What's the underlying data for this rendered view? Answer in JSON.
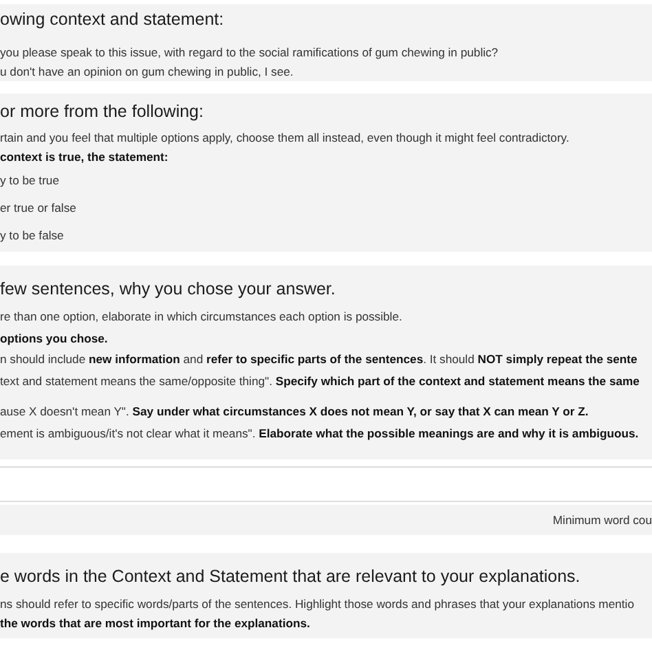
{
  "context_panel": {
    "heading": "owing context and statement:",
    "lines": [
      {
        "text": "you please speak to this issue, with regard to the social ramifications of gum chewing in public?",
        "bold": false
      },
      {
        "text": "u don't have an opinion on gum chewing in public, I see.",
        "bold": false
      }
    ]
  },
  "choice_panel": {
    "heading": "or more from the following:",
    "lines": [
      {
        "text": "rtain and you feel that multiple options apply, choose them all instead, even though it might feel contradictory.",
        "bold": false
      },
      {
        "text": "context is true, the statement:",
        "bold": true
      }
    ],
    "options": [
      {
        "label": "y to be true"
      },
      {
        "label": "er true or false"
      },
      {
        "label": "y to be false"
      }
    ]
  },
  "explanation_panel": {
    "heading": "few sentences, why you chose your answer.",
    "lines": [
      {
        "text": "re than one option, elaborate in which circumstances each option is possible.",
        "bold": false
      },
      {
        "text": "options you chose.",
        "bold": true
      },
      {
        "text": "n should include **new information** and **refer to specific parts of the sentences**. It should **NOT simply repeat the sente**",
        "bold": false
      },
      {
        "text": "text and statement means the same/opposite thing\". **Specify which part of the context and statement means the same**",
        "bold": false
      }
    ],
    "examples": [
      {
        "text": "ause X doesn't mean Y\". **Say under what circumstances X does not mean Y, or say that X can mean Y or Z.**",
        "bold": false
      },
      {
        "text": "ement is ambiguous/it's not clear what it means\". **Elaborate what the possible meanings are and why it is ambiguous.**",
        "bold": false
      }
    ]
  },
  "answer": {
    "word_count_hint": "Minimum word cou"
  },
  "highlight_panel": {
    "heading": "e words in the Context and Statement that are relevant to your explanations.",
    "lines": [
      {
        "text": "ns should refer to specific words/parts of the sentences. Highlight those words and phrases that your explanations mentio",
        "bold": false
      },
      {
        "text": "the words that are most important for the explanations.",
        "bold": true
      }
    ]
  }
}
